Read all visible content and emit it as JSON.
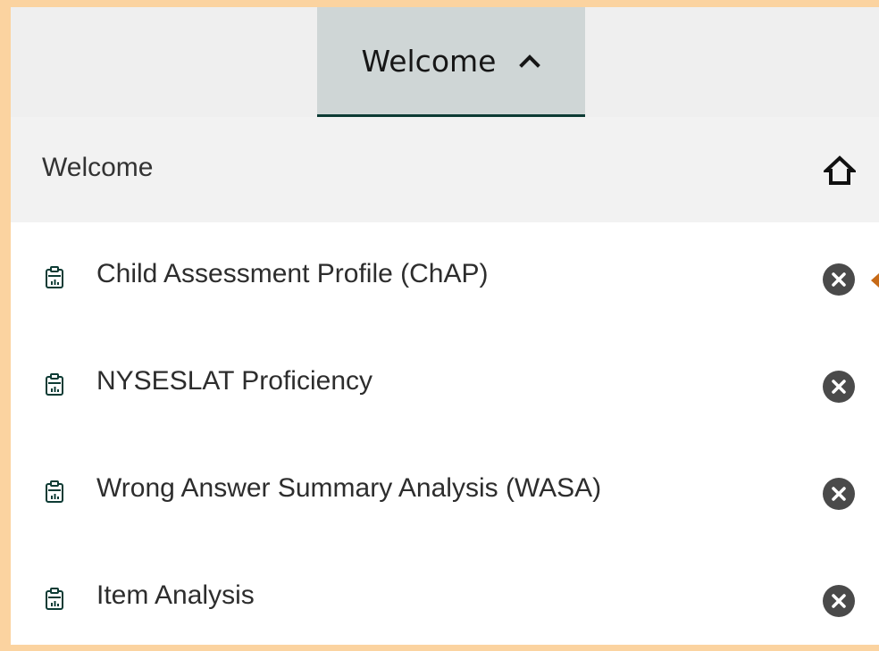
{
  "tab": {
    "label": "Welcome",
    "icon": "chevron-up-icon"
  },
  "home_row": {
    "label": "Welcome",
    "icon": "home-icon"
  },
  "report_icon": "report-clipboard-icon",
  "close_icon": "close-circle-icon",
  "items": [
    {
      "label": "Child Assessment Profile (ChAP)"
    },
    {
      "label": "NYSESLAT Proficiency"
    },
    {
      "label": "Wrong Answer Summary Analysis (WASA)"
    },
    {
      "label": "Item Analysis"
    }
  ],
  "colors": {
    "background": "#fbd3a0",
    "active_tab": "#cfd6d6",
    "active_tab_indicator": "#0d3b34",
    "home_row": "#f2f2f2",
    "close_icon": "#4a4a4a",
    "arrow_accent": "#c76a17"
  }
}
